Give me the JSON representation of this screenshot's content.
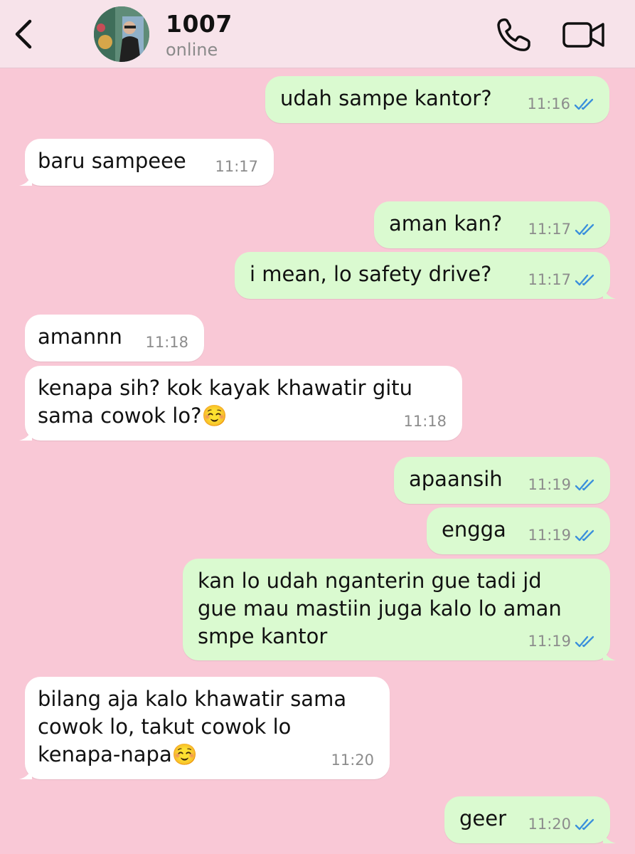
{
  "header": {
    "contact_name": "1007",
    "status": "online"
  },
  "icons": {
    "back": "chevron-left-icon",
    "call": "phone-icon",
    "video": "video-camera-icon"
  },
  "colors": {
    "background": "#f9c8d6",
    "header": "#f7e3ea",
    "outgoing_bubble": "#dafad0",
    "incoming_bubble": "#ffffff",
    "read_ticks": "#3a8fdc"
  },
  "messages": [
    {
      "dir": "out",
      "text": "udah sampe kantor?",
      "time": "11:16",
      "read": true
    },
    {
      "dir": "in",
      "text": "baru sampeee",
      "time": "11:17"
    },
    {
      "dir": "out",
      "text": "aman kan?",
      "time": "11:17",
      "read": true
    },
    {
      "dir": "out",
      "text": "i mean, lo safety drive?",
      "time": "11:17",
      "read": true
    },
    {
      "dir": "in",
      "text": "amannn",
      "time": "11:18"
    },
    {
      "dir": "in",
      "text": "kenapa sih? kok kayak khawatir gitu\nsama cowok lo?☺️",
      "time": "11:18"
    },
    {
      "dir": "out",
      "text": "apaansih",
      "time": "11:19",
      "read": true
    },
    {
      "dir": "out",
      "text": "engga",
      "time": "11:19",
      "read": true
    },
    {
      "dir": "out",
      "text": "kan lo udah nganterin gue tadi jd\ngue mau mastiin juga kalo lo aman\nsmpe kantor",
      "time": "11:19",
      "read": true
    },
    {
      "dir": "in",
      "text": "bilang aja kalo khawatir sama\ncowok lo, takut cowok lo\nkenapa-napa☺️",
      "time": "11:20"
    },
    {
      "dir": "out",
      "text": "geer",
      "time": "11:20",
      "read": true
    }
  ]
}
